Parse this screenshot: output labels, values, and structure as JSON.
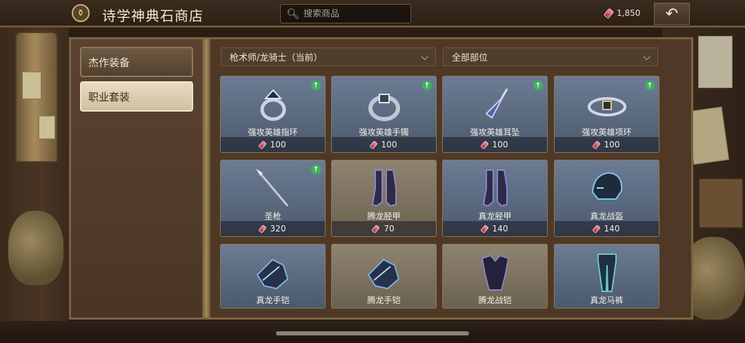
{
  "header": {
    "title": "诗学神典石商店",
    "search_placeholder": "搜索商品",
    "currency_amount": "1,850"
  },
  "sidebar": {
    "items": [
      {
        "label": "杰作装备",
        "active": false
      },
      {
        "label": "职业套装",
        "active": true
      }
    ]
  },
  "filters": {
    "class_filter": "枪术师/龙骑士（当前）",
    "slot_filter": "全部部位"
  },
  "items": [
    {
      "name": "强攻英雄指环",
      "price": "100",
      "upgrade": true,
      "bg": "blue",
      "icon": "ring-icon"
    },
    {
      "name": "强攻英雄手镯",
      "price": "100",
      "upgrade": true,
      "bg": "blue",
      "icon": "bracelet-icon"
    },
    {
      "name": "强攻英雄耳坠",
      "price": "100",
      "upgrade": true,
      "bg": "blue",
      "icon": "earring-icon"
    },
    {
      "name": "强攻英雄项环",
      "price": "100",
      "upgrade": true,
      "bg": "blue",
      "icon": "necklace-icon"
    },
    {
      "name": "圣枪",
      "price": "320",
      "upgrade": true,
      "bg": "blue",
      "icon": "spear-icon"
    },
    {
      "name": "腾龙胫甲",
      "price": "70",
      "upgrade": false,
      "bg": "beige",
      "icon": "greaves-icon"
    },
    {
      "name": "真龙胫甲",
      "price": "140",
      "upgrade": false,
      "bg": "blue",
      "icon": "greaves-icon"
    },
    {
      "name": "真龙战盔",
      "price": "140",
      "upgrade": false,
      "bg": "blue",
      "icon": "helmet-icon"
    },
    {
      "name": "真龙手铠",
      "price": "",
      "upgrade": false,
      "bg": "blue",
      "icon": "gauntlet-icon"
    },
    {
      "name": "腾龙手铠",
      "price": "",
      "upgrade": false,
      "bg": "beige",
      "icon": "gauntlet-icon"
    },
    {
      "name": "腾龙战铠",
      "price": "",
      "upgrade": false,
      "bg": "beige",
      "icon": "armor-icon"
    },
    {
      "name": "真龙马裤",
      "price": "",
      "upgrade": false,
      "bg": "blue",
      "icon": "breeches-icon"
    }
  ],
  "colors": {
    "upgrade_arrow": "#3fb25c",
    "currency_gem": "#d8334f",
    "active_tab": "#e8dcc1"
  }
}
